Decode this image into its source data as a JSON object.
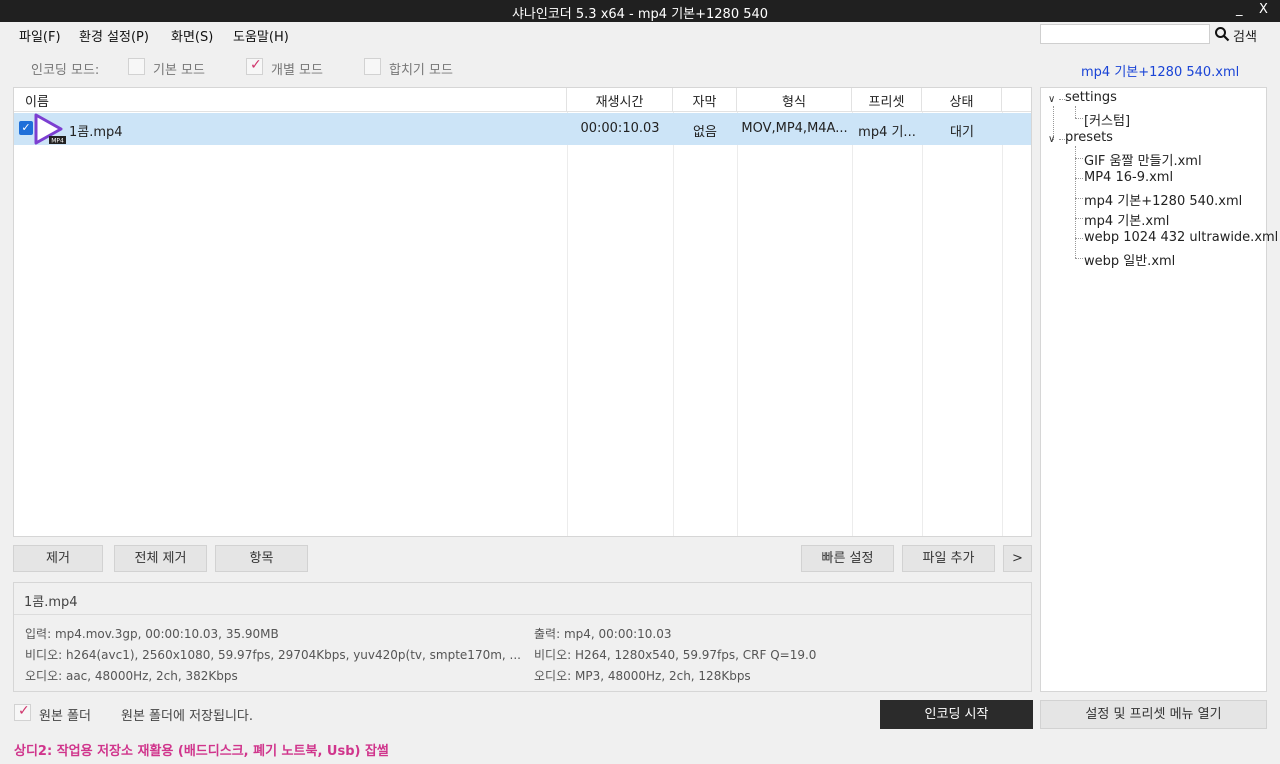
{
  "window": {
    "title": "샤나인코더  5.3 x64  -  mp4 기본+1280  540",
    "minimize": "_",
    "close": "X"
  },
  "menu": [
    "파일(F)",
    "환경 설정(P)",
    "화면(S)",
    "도움말(H)"
  ],
  "search": {
    "value": "",
    "label": "검색"
  },
  "encoding_mode": {
    "label": "인코딩 모드:",
    "options": [
      {
        "label": "기본 모드",
        "checked": false
      },
      {
        "label": "개별 모드",
        "checked": true
      },
      {
        "label": "합치기 모드",
        "checked": false
      }
    ]
  },
  "current_preset": "mp4 기본+1280 540.xml",
  "file_table": {
    "columns": [
      "이름",
      "재생시간",
      "자막",
      "형식",
      "프리셋",
      "상태"
    ],
    "rows": [
      {
        "checked": true,
        "icon_badge": "MP4",
        "name": "1콤.mp4",
        "duration": "00:00:10.03",
        "subtitle": "없음",
        "format": "MOV,MP4,M4A...",
        "preset": "mp4 기...",
        "status": "대기"
      }
    ]
  },
  "buttons": {
    "remove": "제거",
    "remove_all": "전체 제거",
    "items": "항목",
    "quick_settings": "빠른 설정",
    "add_file": "파일 추가",
    "more": ">",
    "start_encoding": "인코딩 시작",
    "open_settings": "설정 및 프리셋 메뉴 열기"
  },
  "info": {
    "filename": "1콤.mp4",
    "input": "입력: mp4.mov.3gp, 00:00:10.03, 35.90MB",
    "input_video": "비디오: h264(avc1), 2560x1080, 59.97fps, 29704Kbps,  yuv420p(tv,  smpte170m, ...",
    "input_audio": "오디오: aac, 48000Hz, 2ch, 382Kbps",
    "output": "출력: mp4, 00:00:10.03",
    "output_video": "비디오: H264, 1280x540, 59.97fps, CRF Q=19.0",
    "output_audio": "오디오: MP3, 48000Hz, 2ch, 128Kbps"
  },
  "output_folder": {
    "checked": true,
    "label": "원본 폴더",
    "note": "원본 폴더에 저장됩니다."
  },
  "tree": {
    "settings": {
      "label": "settings",
      "children": [
        "[커스텀]"
      ]
    },
    "presets": {
      "label": "presets",
      "children": [
        "GIF 움짤 만들기.xml",
        "MP4 16-9.xml",
        "mp4 기본+1280 540.xml",
        "mp4 기본.xml",
        "webp 1024 432 ultrawide.xml",
        "webp 일반.xml"
      ]
    }
  },
  "status_message": "상디2: 작업용 저장소 재활용 (배드디스크, 폐기 노트북, Usb) 잡썰",
  "colors": {
    "accent_pink": "#d0358c",
    "preset_blue": "#1a44d6",
    "row_selected": "#cce4f7",
    "start_button": "#2b2b2b",
    "play_icon": "#7c3fd1"
  },
  "icons": [
    "search-icon",
    "play-file-icon",
    "checkbox-icon",
    "chevron-down-icon"
  ]
}
